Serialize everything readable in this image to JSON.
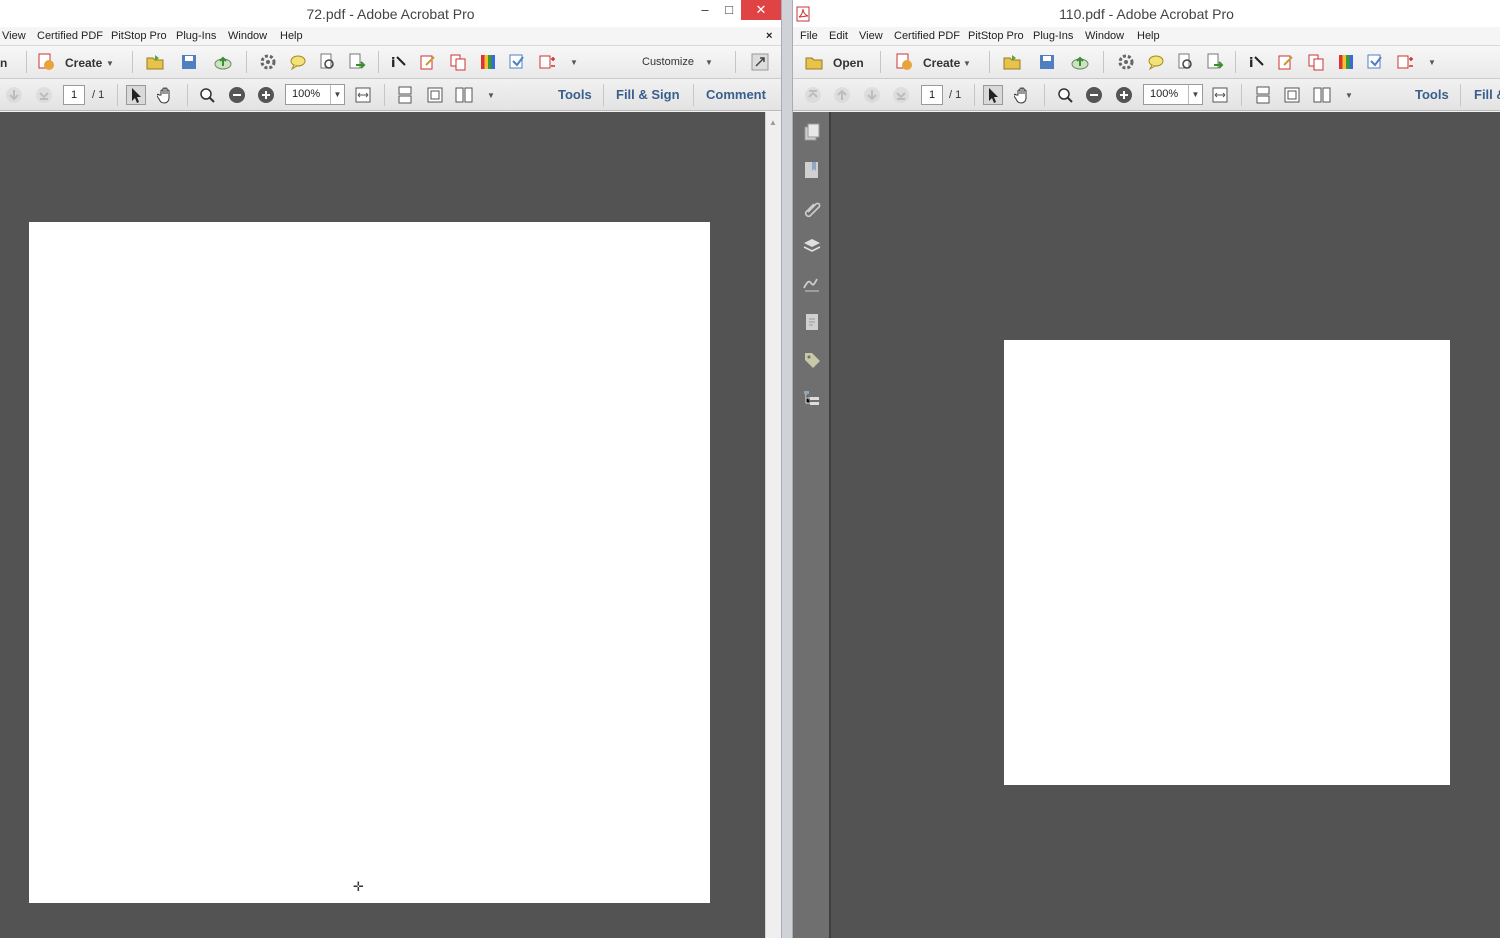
{
  "left_window": {
    "title": "72.pdf - Adobe Acrobat Pro",
    "controls": {
      "minimize": "–",
      "maximize": "□",
      "close": "✕"
    },
    "menu": [
      "View",
      "Certified PDF",
      "PitStop Pro",
      "Plug-Ins",
      "Window",
      "Help"
    ],
    "menu_close": "×",
    "toolbar": {
      "open_partial": "n",
      "create_label": "Create",
      "customize_label": "Customize"
    },
    "nav": {
      "page_value": "1",
      "page_total": "/ 1",
      "zoom_value": "100%"
    },
    "panes": {
      "tools": "Tools",
      "fill_sign": "Fill & Sign",
      "comment": "Comment"
    },
    "cursor": "crosshair-cursor"
  },
  "right_window": {
    "title": "110.pdf - Adobe Acrobat Pro",
    "menu": [
      "File",
      "Edit",
      "View",
      "Certified PDF",
      "PitStop Pro",
      "Plug-Ins",
      "Window",
      "Help"
    ],
    "toolbar": {
      "open_label": "Open",
      "create_label": "Create"
    },
    "nav": {
      "page_value": "1",
      "page_total": "/ 1",
      "zoom_value": "100%"
    },
    "panes": {
      "tools": "Tools",
      "fill_sign_partial": "Fill &"
    },
    "nav_panel_icons": [
      "page-thumbnails-icon",
      "bookmarks-icon",
      "attachments-icon",
      "layers-icon",
      "signatures-icon",
      "content-icon",
      "tags-icon",
      "model-tree-icon"
    ]
  },
  "colors": {
    "doc_background": "#535353",
    "close_button": "#e04343",
    "pane_link": "#3a5f8c"
  }
}
